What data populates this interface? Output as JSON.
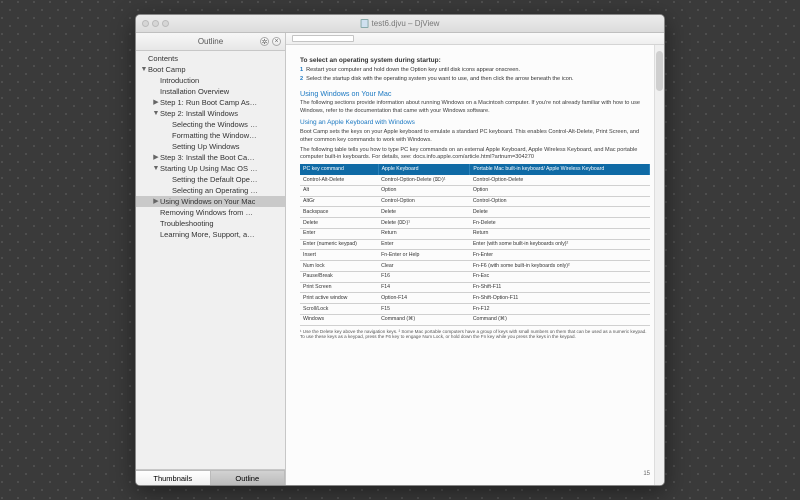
{
  "window": {
    "title": "test6.djvu – DjView"
  },
  "sidebar": {
    "header": "Outline",
    "tabs": {
      "thumbnails": "Thumbnails",
      "outline": "Outline"
    }
  },
  "outline": [
    {
      "label": "Contents",
      "depth": 0,
      "tw": ""
    },
    {
      "label": "Boot Camp",
      "depth": 0,
      "tw": "▼"
    },
    {
      "label": "Introduction",
      "depth": 1,
      "tw": ""
    },
    {
      "label": "Installation Overview",
      "depth": 1,
      "tw": ""
    },
    {
      "label": "Step 1:  Run Boot Camp As…",
      "depth": 1,
      "tw": "▶"
    },
    {
      "label": "Step 2:  Install Windows",
      "depth": 1,
      "tw": "▼"
    },
    {
      "label": "Selecting the Windows …",
      "depth": 2,
      "tw": ""
    },
    {
      "label": "Formatting the Window…",
      "depth": 2,
      "tw": ""
    },
    {
      "label": "Setting Up Windows",
      "depth": 2,
      "tw": ""
    },
    {
      "label": "Step 3:  Install the Boot Ca…",
      "depth": 1,
      "tw": "▶"
    },
    {
      "label": "Starting Up Using Mac OS …",
      "depth": 1,
      "tw": "▼"
    },
    {
      "label": "Setting the Default Ope…",
      "depth": 2,
      "tw": ""
    },
    {
      "label": "Selecting an Operating …",
      "depth": 2,
      "tw": ""
    },
    {
      "label": "Using Windows on Your Mac",
      "depth": 1,
      "tw": "▶",
      "sel": true
    },
    {
      "label": "Removing Windows from …",
      "depth": 1,
      "tw": ""
    },
    {
      "label": "Troubleshooting",
      "depth": 1,
      "tw": ""
    },
    {
      "label": "Learning More, Support, a…",
      "depth": 1,
      "tw": ""
    }
  ],
  "doc": {
    "select_heading": "To select an operating system during startup:",
    "select_steps": [
      "Restart your computer and hold down the Option key until disk icons appear onscreen.",
      "Select the startup disk with the operating system you want to use, and then click the arrow beneath the icon."
    ],
    "h1": "Using Windows on Your Mac",
    "p1": "The following sections provide information about running Windows on a Macintosh computer. If you're not already familiar with how to use Windows, refer to the documentation that came with your Windows software.",
    "h2": "Using an Apple Keyboard with Windows",
    "p2": "Boot Camp sets the keys on your Apple keyboard to emulate a standard PC keyboard. This enables Control-Alt-Delete, Print Screen, and other common key commands to work with Windows.",
    "p3": "The following table tells you how to type PC key commands on an external Apple Keyboard, Apple Wireless Keyboard, and Mac portable computer built-in keyboards. For details, see:  docs.info.apple.com/article.html?artnum=304270",
    "table": {
      "headers": [
        "PC key command",
        "Apple Keyboard",
        "Portable Mac built-in keyboard/ Apple Wireless Keyboard"
      ],
      "rows": [
        [
          "Control-Alt-Delete",
          "Control-Option-Delete (⌦)¹",
          "Control-Option-Delete"
        ],
        [
          "Alt",
          "Option",
          "Option"
        ],
        [
          "AltGr",
          "Control-Option",
          "Control-Option"
        ],
        [
          "Backspace",
          "Delete",
          "Delete"
        ],
        [
          "Delete",
          "Delete (⌦)¹",
          "Fn-Delete"
        ],
        [
          "Enter",
          "Return",
          "Return"
        ],
        [
          "Enter (numeric keypad)",
          "Enter",
          "Enter (with some built-in keyboards only)²"
        ],
        [
          "Insert",
          "Fn-Enter or Help",
          "Fn-Enter"
        ],
        [
          "Num lock",
          "Clear",
          "Fn-F6 (with some built-in keyboards only)²"
        ],
        [
          "Pause/Break",
          "F16",
          "Fn-Esc"
        ],
        [
          "Print Screen",
          "F14",
          "Fn-Shift-F11"
        ],
        [
          "Print active window",
          "Option-F14",
          "Fn-Shift-Option-F11"
        ],
        [
          "Scroll/Lock",
          "F15",
          "Fn-F12"
        ],
        [
          "Windows",
          "Command (⌘)",
          "Command (⌘)"
        ]
      ]
    },
    "footnote": "¹ Use the Delete key above the navigation keys.\n² Some Mac portable computers have a group of keys with small numbers on them that can be used as a numeric keypad. To use these keys as a keypad, press the F6 key to engage Num Lock, or hold down the Fn key while you press the keys in the keypad.",
    "page_number": "15"
  }
}
